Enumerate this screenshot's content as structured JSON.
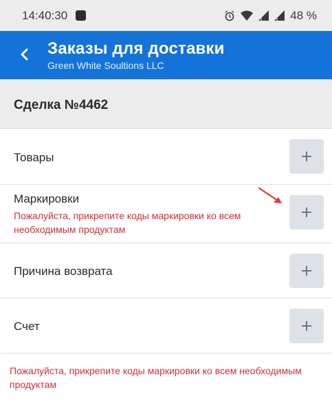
{
  "status_bar": {
    "time": "14:40:30",
    "battery": "48 %",
    "icons": [
      "notification-square-icon",
      "alarm-icon",
      "wifi-icon",
      "signal-icon",
      "signal-icon",
      "battery-icon"
    ]
  },
  "app_bar": {
    "title": "Заказы для доставки",
    "subtitle": "Green White Soultions LLC",
    "back_icon": "chevron-left-icon",
    "color": "#1473d9"
  },
  "deal": {
    "title": "Сделка №4462"
  },
  "sections": [
    {
      "label": "Товары",
      "warning": ""
    },
    {
      "label": "Маркировки",
      "warning": "Пожалуйста, прикрепите коды маркировки ко всем необходимым продуктам"
    },
    {
      "label": "Причина возврата",
      "warning": ""
    },
    {
      "label": "Счет",
      "warning": ""
    }
  ],
  "bottom_warning": "Пожалуйста, прикрепите коды маркировки ко всем необходимым продуктам",
  "colors": {
    "warning": "#d32f2f",
    "plus_button_bg": "#dde2e8",
    "annotation_arrow": "#e53935"
  }
}
